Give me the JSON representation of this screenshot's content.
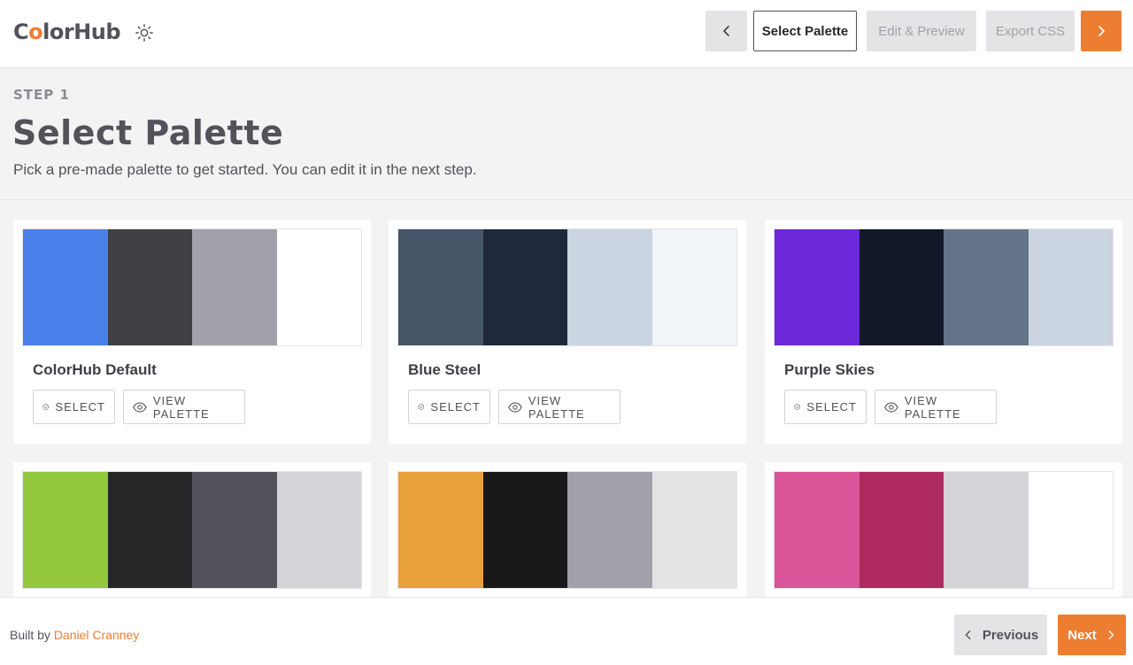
{
  "app": {
    "logo_prefix": "C",
    "logo_accent": "o",
    "logo_suffix": "lorHub"
  },
  "header": {
    "steps": [
      {
        "label": "Select Palette",
        "state": "active"
      },
      {
        "label": "Edit & Preview",
        "state": "disabled"
      },
      {
        "label": "Export CSS",
        "state": "disabled"
      }
    ],
    "prev_icon": "chevron-left-icon",
    "next_icon": "chevron-right-icon",
    "theme_icon": "sun-icon"
  },
  "intro": {
    "step_label": "STEP 1",
    "title": "Select Palette",
    "description": "Pick a pre-made palette to get started. You can edit it in the next step."
  },
  "palettes": [
    {
      "name": "ColorHub Default",
      "colors": [
        "#4a80ea",
        "#3f3f46",
        "#a1a1aa",
        "#ffffff"
      ]
    },
    {
      "name": "Blue Steel",
      "colors": [
        "#475569",
        "#1e293b",
        "#cbd5e1",
        "#f1f5f9"
      ]
    },
    {
      "name": "Purple Skies",
      "colors": [
        "#6d28d9",
        "#111827",
        "#64748b",
        "#cbd5e1"
      ]
    },
    {
      "name": "",
      "colors": [
        "#94c83d",
        "#27272a",
        "#52525b",
        "#d4d4d8"
      ]
    },
    {
      "name": "",
      "colors": [
        "#e8a03a",
        "#18181b",
        "#a1a1aa",
        "#e4e4e7"
      ]
    },
    {
      "name": "",
      "colors": [
        "#db559a",
        "#ae2a5f",
        "#d4d4d8",
        "#ffffff"
      ]
    }
  ],
  "card_actions": {
    "select_label": "SELECT",
    "view_label": "VIEW PALETTE",
    "select_icon": "check-circle-icon",
    "view_icon": "eye-icon"
  },
  "footer": {
    "credit_prefix": "Built by",
    "credit_author": "Daniel Cranney",
    "previous_label": "Previous",
    "next_label": "Next"
  },
  "colors": {
    "accent": "#ed7d31",
    "text": "#52525b",
    "background": "#f3f3f4"
  }
}
